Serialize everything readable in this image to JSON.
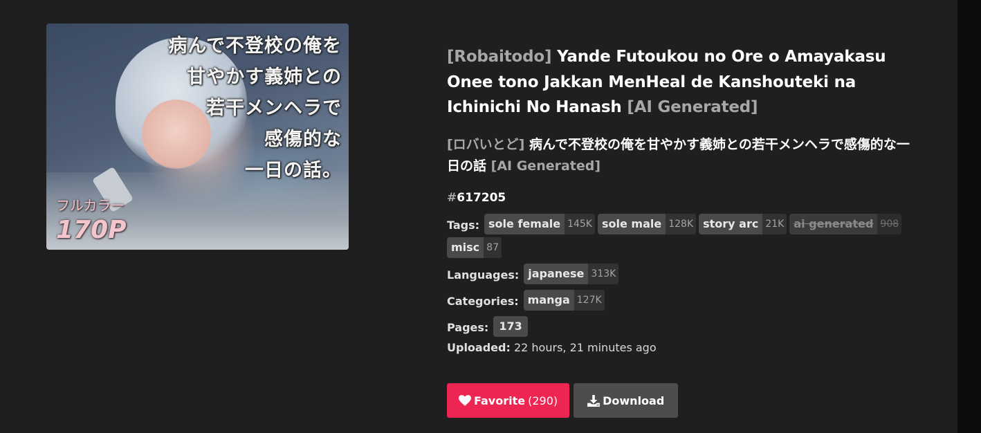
{
  "cover": {
    "overlay_lines": [
      "病んで不登校の俺を",
      "甘やかす義姉との",
      "若干メンヘラで",
      "感傷的な",
      "一日の話。"
    ],
    "badge_small": "フルカラー",
    "badge_big": "170P"
  },
  "title_en": {
    "prefix": "[Robaitodo]",
    "main": "Yande Futoukou no Ore o Amayakasu Onee tono Jakkan MenHeal de Kanshouteki na Ichinichi No Hanash",
    "suffix": "[AI Generated]"
  },
  "title_ja": {
    "prefix": "[ロバいとど]",
    "main": "病んで不登校の俺を甘やかす義姉との若干メンヘラで感傷的な一日の話",
    "suffix": "[AI Generated]"
  },
  "gallery_id": {
    "hash": "#",
    "value": "617205"
  },
  "tags": {
    "label": "Tags:",
    "items": [
      {
        "name": "sole female",
        "count": "145K"
      },
      {
        "name": "sole male",
        "count": "128K"
      },
      {
        "name": "story arc",
        "count": "21K"
      },
      {
        "name": "ai generated",
        "count": "908"
      },
      {
        "name": "misc",
        "count": "87"
      }
    ]
  },
  "languages": {
    "label": "Languages:",
    "items": [
      {
        "name": "japanese",
        "count": "313K"
      }
    ]
  },
  "categories": {
    "label": "Categories:",
    "items": [
      {
        "name": "manga",
        "count": "127K"
      }
    ]
  },
  "pages": {
    "label": "Pages:",
    "value": "173"
  },
  "uploaded": {
    "label": "Uploaded:",
    "value": "22 hours, 21 minutes ago"
  },
  "buttons": {
    "favorite": {
      "label": "Favorite",
      "count": "(290)",
      "icon": "heart-icon",
      "color": "#ed2553"
    },
    "download": {
      "label": "Download",
      "icon": "download-icon",
      "color": "#4d4d4d"
    }
  }
}
